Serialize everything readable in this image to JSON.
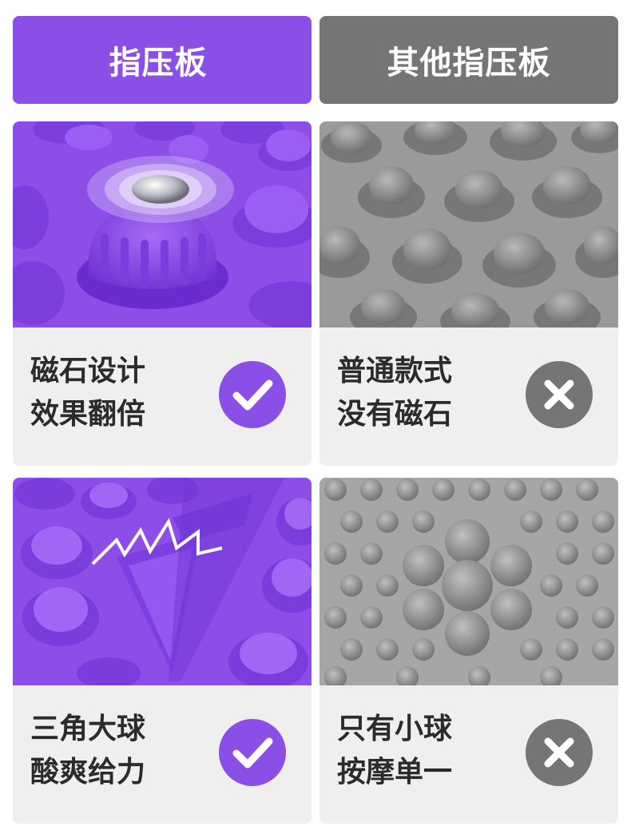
{
  "headers": {
    "left": "指压板",
    "right": "其他指压板"
  },
  "cards": [
    {
      "line1": "磁石设计",
      "line2": "效果翻倍",
      "status": "check-icon"
    },
    {
      "line1": "普通款式",
      "line2": "没有磁石",
      "status": "cross-icon"
    },
    {
      "line1": "三角大球",
      "line2": "酸爽给力",
      "status": "check-icon"
    },
    {
      "line1": "只有小球",
      "line2": "按摩单一",
      "status": "cross-icon"
    }
  ],
  "colors": {
    "purple": "#8a4fe6",
    "gray": "#757575",
    "caption_bg": "#efefef"
  }
}
